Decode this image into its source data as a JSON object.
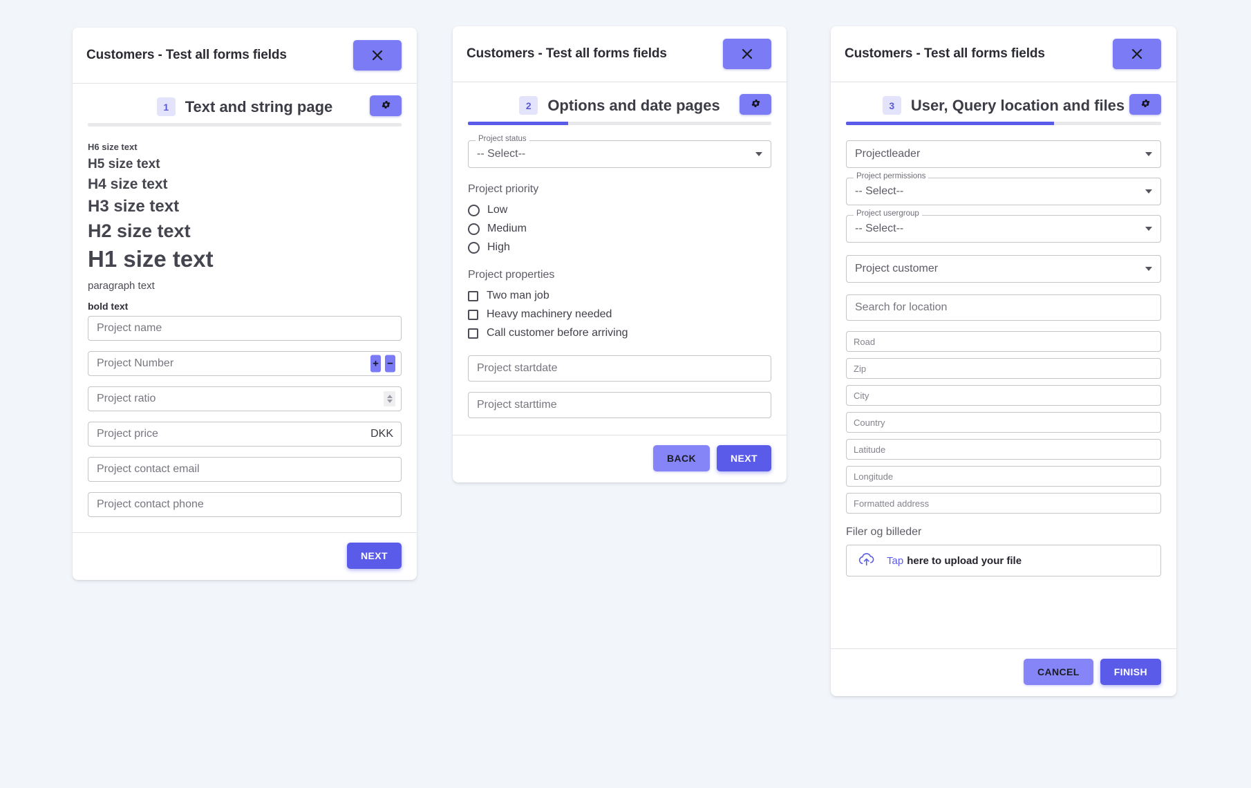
{
  "theme": {
    "page_bg": "#f2f5f9",
    "accent": "#5b5bea",
    "accent_light": "#7b7bf5",
    "badge_bg": "#e3e3fb",
    "badge_text": "#5a5ad6"
  },
  "cards": [
    {
      "window_title": "Customers - Test all forms fields",
      "close_icon": "close-icon",
      "gear_icon": "gear-icon",
      "step_number": "1",
      "step_title": "Text and string page",
      "progress_percent": 0,
      "typography": {
        "h6": "H6 size text",
        "h5": "H5 size text",
        "h4": "H4 size text",
        "h3": "H3 size text",
        "h2": "H2 size text",
        "h1": "H1 size text",
        "paragraph": "paragraph text",
        "bold": "bold text"
      },
      "fields": {
        "project_name": {
          "placeholder": "Project name",
          "value": ""
        },
        "project_number": {
          "placeholder": "Project Number",
          "value": "",
          "increment_label": "+",
          "decrement_label": "−"
        },
        "project_ratio": {
          "placeholder": "Project ratio",
          "value": ""
        },
        "project_price": {
          "placeholder": "Project price",
          "value": "",
          "suffix": "DKK"
        },
        "project_contact_email": {
          "placeholder": "Project contact email",
          "value": ""
        },
        "project_contact_phone": {
          "placeholder": "Project contact phone",
          "value": ""
        }
      },
      "footer": {
        "next_label": "NEXT"
      }
    },
    {
      "window_title": "Customers - Test all forms fields",
      "close_icon": "close-icon",
      "gear_icon": "gear-icon",
      "step_number": "2",
      "step_title": "Options and date pages",
      "progress_percent": 33,
      "project_status": {
        "legend": "Project status",
        "value": "-- Select--"
      },
      "priority": {
        "label": "Project priority",
        "options": [
          {
            "label": "Low",
            "selected": false
          },
          {
            "label": "Medium",
            "selected": false
          },
          {
            "label": "High",
            "selected": false
          }
        ]
      },
      "properties": {
        "label": "Project properties",
        "options": [
          {
            "label": "Two man job",
            "checked": false
          },
          {
            "label": "Heavy machinery needed",
            "checked": false
          },
          {
            "label": "Call customer before arriving",
            "checked": false
          }
        ]
      },
      "fields": {
        "project_startdate": {
          "placeholder": "Project startdate",
          "value": ""
        },
        "project_starttime": {
          "placeholder": "Project starttime",
          "value": ""
        }
      },
      "footer": {
        "back_label": "BACK",
        "next_label": "NEXT"
      }
    },
    {
      "window_title": "Customers - Test all forms fields",
      "close_icon": "close-icon",
      "gear_icon": "gear-icon",
      "step_number": "3",
      "step_title": "User, Query location and files",
      "progress_percent": 66,
      "selects": {
        "projectleader": {
          "legend": "",
          "value": "Projectleader"
        },
        "project_permissions": {
          "legend": "Project permissions",
          "value": "-- Select--"
        },
        "project_usergroup": {
          "legend": "Project usergroup",
          "value": "-- Select--"
        },
        "project_customer": {
          "legend": "",
          "value": "Project customer"
        }
      },
      "fields": {
        "search_location": {
          "placeholder": "Search for location",
          "value": ""
        },
        "road": {
          "placeholder": "Road",
          "value": ""
        },
        "zip": {
          "placeholder": "Zip",
          "value": ""
        },
        "city": {
          "placeholder": "City",
          "value": ""
        },
        "country": {
          "placeholder": "Country",
          "value": ""
        },
        "latitude": {
          "placeholder": "Latitude",
          "value": ""
        },
        "longitude": {
          "placeholder": "Longitude",
          "value": ""
        },
        "formatted_address": {
          "placeholder": "Formatted address",
          "value": ""
        }
      },
      "files": {
        "label": "Filer og billeder",
        "upload_icon": "cloud-upload-icon",
        "upload_link_text": "Tap",
        "upload_rest_text": "here to upload your file"
      },
      "footer": {
        "cancel_label": "CANCEL",
        "finish_label": "FINISH"
      }
    }
  ]
}
